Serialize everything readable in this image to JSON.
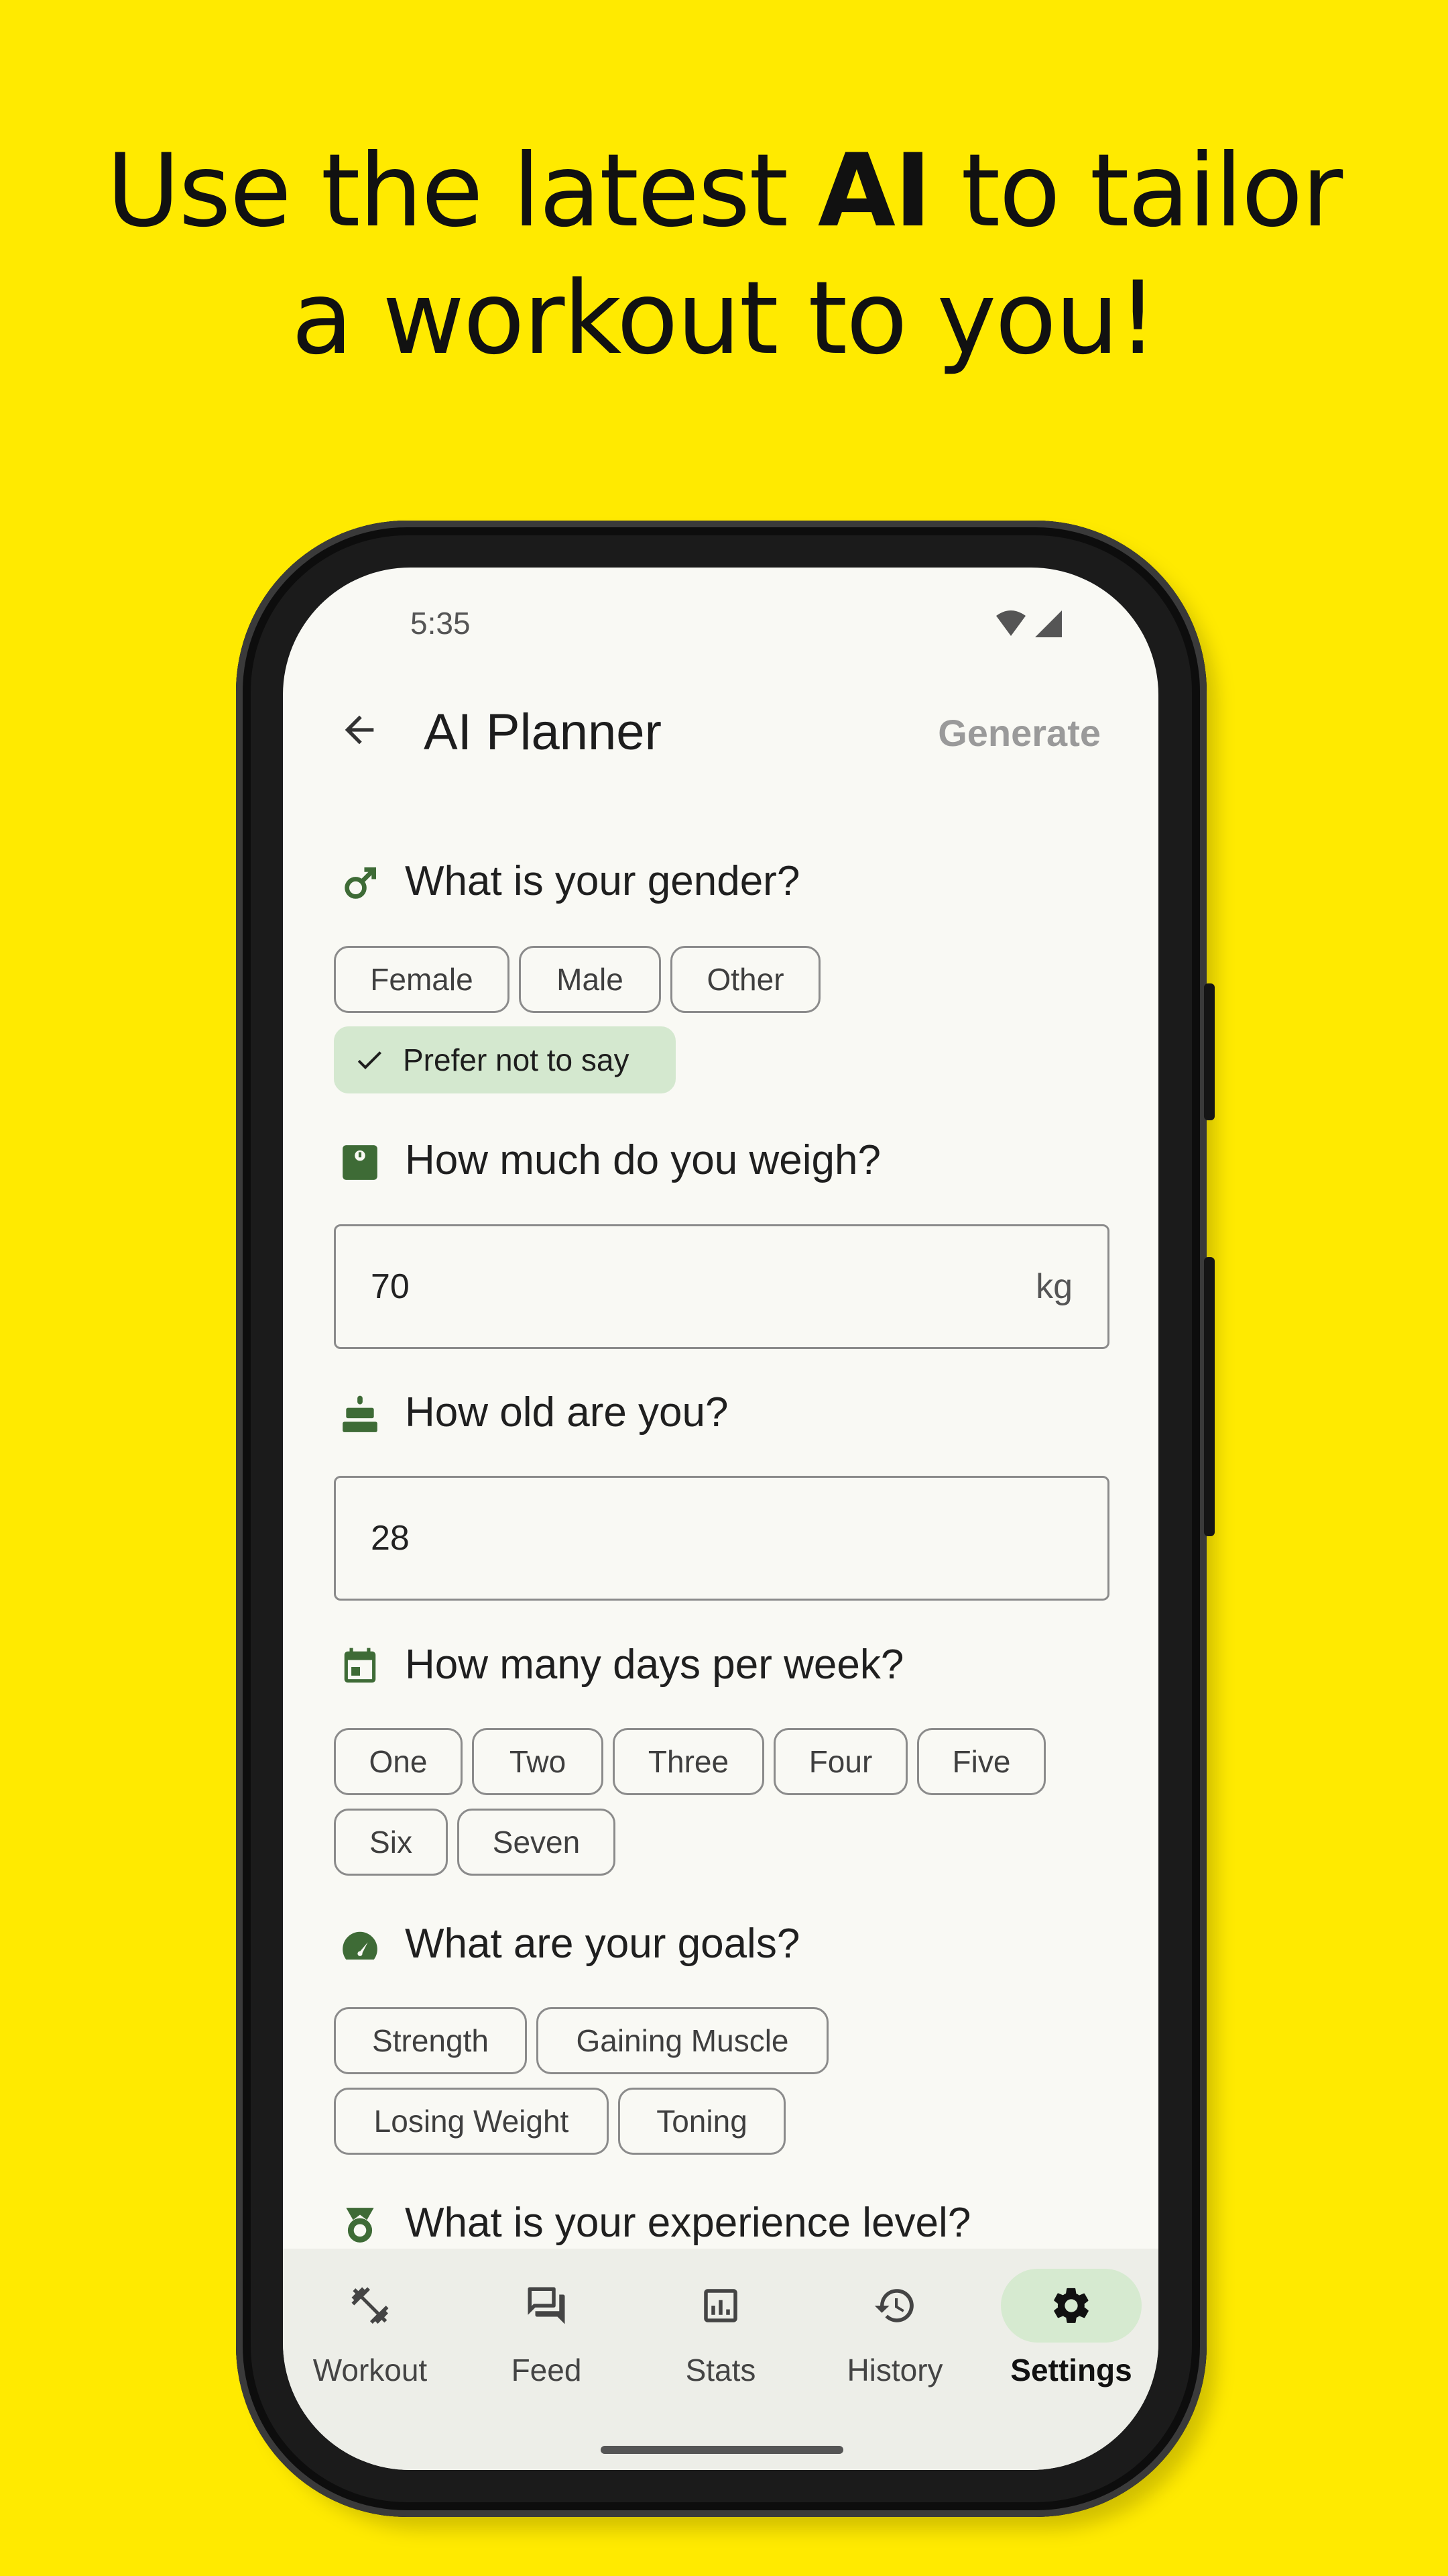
{
  "headline": {
    "line1_pre": "Use the latest ",
    "line1_bold": "AI",
    "line1_post": " to tailor",
    "line2": "a workout to you!"
  },
  "status_bar": {
    "time": "5:35",
    "icons": [
      "wifi-icon",
      "signal-icon"
    ]
  },
  "app_bar": {
    "title": "AI Planner",
    "action": "Generate",
    "back_icon": "arrow-back-icon"
  },
  "sections": {
    "gender": {
      "question": "What is your gender?",
      "icon": "male-icon",
      "options": [
        "Female",
        "Male",
        "Other",
        "Prefer not to say"
      ],
      "selected": "Prefer not to say"
    },
    "weight": {
      "question": "How much do you weigh?",
      "icon": "scale-icon",
      "value": "70",
      "unit": "kg"
    },
    "age": {
      "question": "How old are you?",
      "icon": "cake-icon",
      "value": "28"
    },
    "days": {
      "question": "How many days per week?",
      "icon": "calendar-icon",
      "options": [
        "One",
        "Two",
        "Three",
        "Four",
        "Five",
        "Six",
        "Seven"
      ]
    },
    "goals": {
      "question": "What are your goals?",
      "icon": "speedometer-icon",
      "options": [
        "Strength",
        "Gaining Muscle",
        "Losing Weight",
        "Toning"
      ]
    },
    "experience": {
      "question": "What is your experience level?",
      "icon": "medal-icon"
    }
  },
  "bottom_nav": {
    "items": [
      {
        "label": "Workout",
        "icon": "dumbbell-icon"
      },
      {
        "label": "Feed",
        "icon": "forum-icon"
      },
      {
        "label": "Stats",
        "icon": "chart-icon"
      },
      {
        "label": "History",
        "icon": "history-icon"
      },
      {
        "label": "Settings",
        "icon": "gear-icon"
      }
    ],
    "active": "Settings"
  },
  "colors": {
    "background": "#FFEA00",
    "accent_green": "#3E6B36",
    "selected_chip": "#D4E8CF",
    "screen": "#F9F9F4"
  }
}
